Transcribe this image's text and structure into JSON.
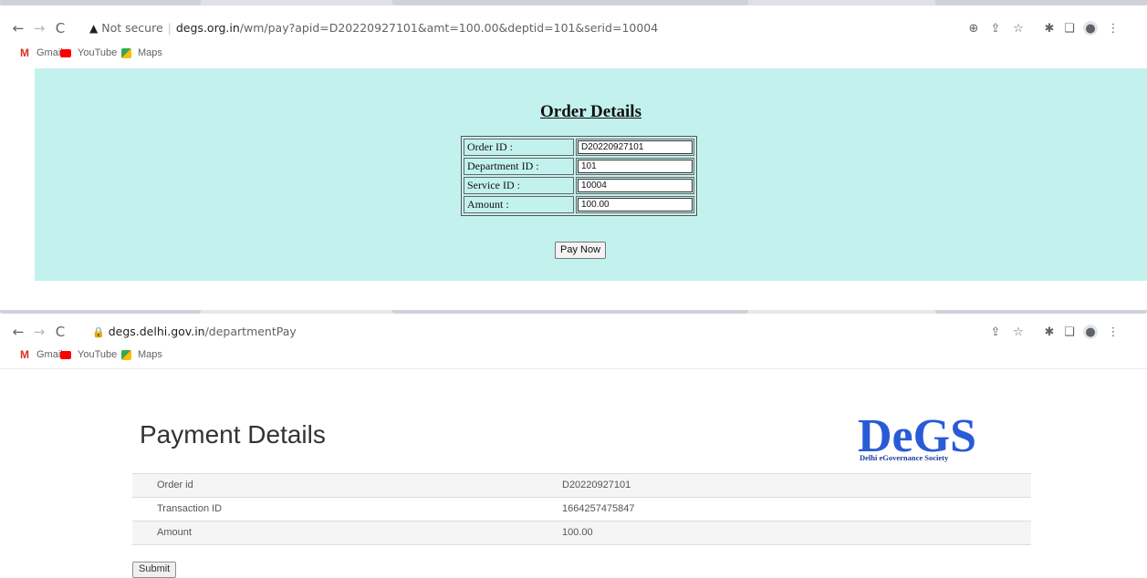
{
  "screen1": {
    "url": {
      "security_label": "Not secure",
      "host": "degs.org.in",
      "path": "/wm/pay?apid=D20220927101&amt=100.00&deptid=101&serid=10004"
    },
    "bookmarks": [
      {
        "label": "Gmail"
      },
      {
        "label": "YouTube"
      },
      {
        "label": "Maps"
      }
    ],
    "order_details": {
      "title": "Order Details",
      "rows": [
        {
          "label": "Order ID :",
          "value": "D20220927101"
        },
        {
          "label": "Department ID :",
          "value": "101"
        },
        {
          "label": "Service ID :",
          "value": "10004"
        },
        {
          "label": "Amount :",
          "value": "100.00"
        }
      ],
      "pay_button": "Pay Now"
    },
    "background_color": "#c3f2ee"
  },
  "screen2": {
    "url": {
      "host": "degs.delhi.gov.in",
      "path": "/departmentPay"
    },
    "bookmarks": [
      {
        "label": "Gmail"
      },
      {
        "label": "YouTube"
      },
      {
        "label": "Maps"
      }
    ],
    "payment_details": {
      "title": "Payment Details",
      "logo": {
        "text": "DeGS",
        "tagline": "Delhi eGovernance Society",
        "color": "#2a5bd7"
      },
      "rows": [
        {
          "label": "Order id",
          "value": "D20220927101"
        },
        {
          "label": "Transaction ID",
          "value": "1664257475847"
        },
        {
          "label": "Amount",
          "value": "100.00"
        }
      ],
      "submit_button": "Submit"
    }
  },
  "icons": [
    "back-icon",
    "forward-icon",
    "reload-icon",
    "warning-icon",
    "lock-icon",
    "zoom-icon",
    "share-icon",
    "star-icon",
    "extensions-icon",
    "sidepanel-icon",
    "profile-icon",
    "menu-icon"
  ]
}
